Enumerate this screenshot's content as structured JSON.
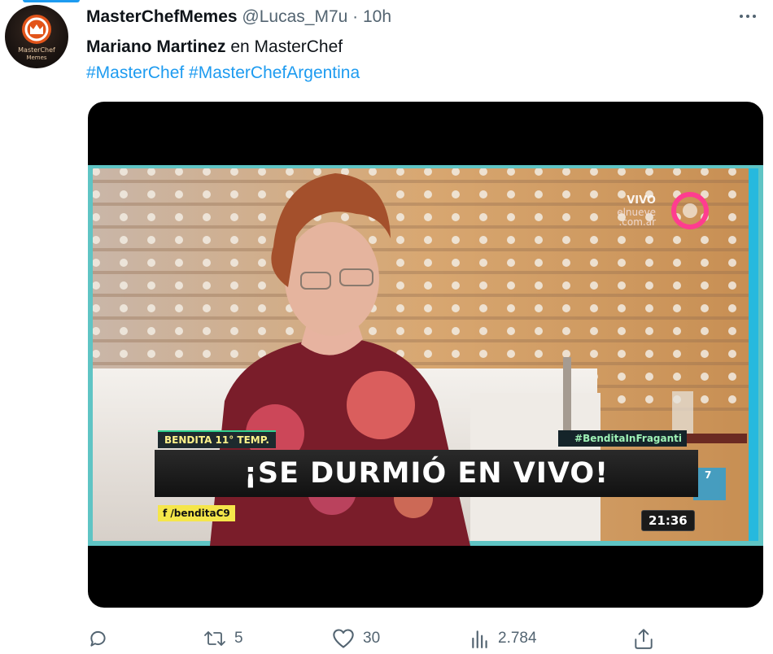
{
  "tweet": {
    "display_name": "MasterChefMemes",
    "handle": "@Lucas_M7u",
    "separator": "·",
    "time": "10h",
    "avatar_icon": "masterchef-logo-icon",
    "avatar_text_line1": "MasterChef",
    "avatar_text_line2": "Memes",
    "text_bold": "Mariano Martinez",
    "text_rest": " en MasterChef",
    "hashtags": "#MasterChef #MasterChefArgentina"
  },
  "video": {
    "vivo_label": "VIVO",
    "site_line1": "elnueve",
    "site_line2": ".com.ar",
    "show_tag": "BENDITA 11° TEMP.",
    "hashtag_tag": "#BenditaInFraganti",
    "headline": "¡SE DURMIÓ EN VIVO!",
    "social": "/benditaC9",
    "clock": "21:36",
    "badge": "7"
  },
  "actions": {
    "reply_count": "",
    "retweet_count": "5",
    "like_count": "30",
    "views_count": "2.784"
  },
  "colors": {
    "link": "#1d9bf0",
    "secondary_text": "#536471",
    "primary_text": "#0f1419"
  }
}
